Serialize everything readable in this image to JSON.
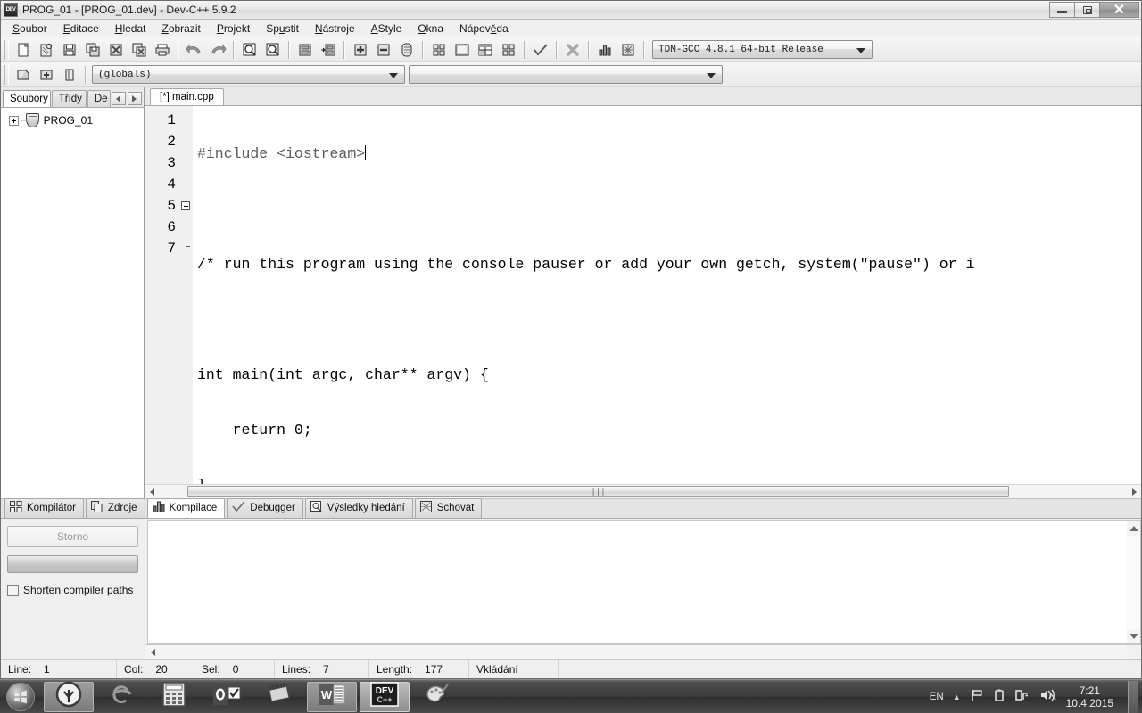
{
  "window": {
    "title": "PROG_01 - [PROG_01.dev] - Dev-C++ 5.9.2",
    "app_icon": "devcpp-icon",
    "minimize_label": "",
    "restore_label": "",
    "close_label": "✕"
  },
  "menubar": {
    "items": [
      {
        "label": "Soubor",
        "accel": "S"
      },
      {
        "label": "Editace",
        "accel": "E"
      },
      {
        "label": "Hledat",
        "accel": "H"
      },
      {
        "label": "Zobrazit",
        "accel": "Z"
      },
      {
        "label": "Projekt",
        "accel": "P"
      },
      {
        "label": "Spustit",
        "accel": "u"
      },
      {
        "label": "Nástroje",
        "accel": "N"
      },
      {
        "label": "AStyle",
        "accel": "A"
      },
      {
        "label": "Okna",
        "accel": "O"
      },
      {
        "label": "Nápověda",
        "accel": "ě"
      }
    ]
  },
  "toolbar1": {
    "buttons": [
      {
        "name": "new-file-icon",
        "tip": "New"
      },
      {
        "name": "open-file-icon",
        "tip": "Open"
      },
      {
        "name": "save-file-icon",
        "tip": "Save"
      },
      {
        "name": "save-all-icon",
        "tip": "Save All"
      },
      {
        "name": "close-file-icon",
        "tip": "Close"
      },
      {
        "name": "close-all-icon",
        "tip": "Close All"
      },
      {
        "name": "print-icon",
        "tip": "Print"
      },
      {
        "name": "undo-icon",
        "tip": "Undo"
      },
      {
        "name": "redo-icon",
        "tip": "Redo"
      },
      {
        "name": "find-icon",
        "tip": "Find"
      },
      {
        "name": "replace-icon",
        "tip": "Replace"
      },
      {
        "name": "goto-line-icon",
        "tip": "Goto Line"
      },
      {
        "name": "goto-function-icon",
        "tip": "Goto Function"
      },
      {
        "name": "insert-icon",
        "tip": "Insert"
      },
      {
        "name": "toggle-icon",
        "tip": "Toggle"
      },
      {
        "name": "bookmark-icon",
        "tip": "Bookmark"
      },
      {
        "name": "compile-icon",
        "tip": "Compile"
      },
      {
        "name": "run-icon",
        "tip": "Run"
      },
      {
        "name": "compile-run-icon",
        "tip": "Compile & Run"
      },
      {
        "name": "rebuild-all-icon",
        "tip": "Rebuild All"
      },
      {
        "name": "check-syntax-icon",
        "tip": "Syntax Check"
      },
      {
        "name": "stop-icon",
        "tip": "Stop Execution"
      },
      {
        "name": "profile-icon",
        "tip": "Profile Analysis"
      },
      {
        "name": "debug-icon",
        "tip": "Debug"
      }
    ],
    "compiler_combo": {
      "value": "TDM-GCC 4.8.1 64-bit Release"
    }
  },
  "toolbar2": {
    "buttons": [
      {
        "name": "project-new-icon",
        "tip": "New Project"
      },
      {
        "name": "project-add-icon",
        "tip": "Add to Project"
      },
      {
        "name": "project-remove-icon",
        "tip": "Remove from Project"
      }
    ],
    "scope_combo": {
      "value": "(globals)"
    },
    "member_combo": {
      "value": ""
    }
  },
  "left_panel": {
    "tabs": [
      {
        "label": "Soubory",
        "active": true
      },
      {
        "label": "Třídy",
        "active": false
      },
      {
        "label": "De",
        "active": false
      }
    ],
    "nav_prev": "◄",
    "nav_next": "►",
    "tree": [
      {
        "label": "PROG_01",
        "icon": "project-shield-icon",
        "expanded": false
      }
    ]
  },
  "editor": {
    "tabs": [
      {
        "label": "[*] main.cpp",
        "active": true
      }
    ],
    "lines": [
      {
        "num": "1",
        "text": "#include <iostream>",
        "style": "preproc",
        "caret": true,
        "fold": "none"
      },
      {
        "num": "2",
        "text": "",
        "style": "plain",
        "caret": false,
        "fold": "none"
      },
      {
        "num": "3",
        "text": "/* run this program using the console pauser or add your own getch, system(\"pause\") or i",
        "style": "plain",
        "caret": false,
        "fold": "none"
      },
      {
        "num": "4",
        "text": "",
        "style": "plain",
        "caret": false,
        "fold": "none"
      },
      {
        "num": "5",
        "text": "int main(int argc, char** argv) {",
        "style": "plain",
        "caret": false,
        "fold": "open"
      },
      {
        "num": "6",
        "text": "    return 0;",
        "style": "plain",
        "caret": false,
        "fold": "body"
      },
      {
        "num": "7",
        "text": "}",
        "style": "plain",
        "caret": false,
        "fold": "end"
      }
    ],
    "hscroll": {
      "left_arrow": "◄",
      "right_arrow": "►",
      "thumb_grip": "|||"
    }
  },
  "bottom_panel": {
    "tabs": [
      {
        "label": "Kompilátor",
        "icon": "compiler-grid-icon",
        "active": false
      },
      {
        "label": "Zdroje",
        "icon": "resources-icon",
        "active": false
      },
      {
        "label": "Kompilace",
        "icon": "compile-log-icon",
        "active": true
      },
      {
        "label": "Debugger",
        "icon": "debugger-check-icon",
        "active": false
      },
      {
        "label": "Výsledky hledání",
        "icon": "search-results-icon",
        "active": false
      },
      {
        "label": "Schovat",
        "icon": "hide-icon",
        "active": false
      }
    ],
    "cancel_button": "Storno",
    "progress_value": "",
    "shorten_paths_label": "Shorten compiler paths",
    "shorten_paths_checked": false,
    "output_text": ""
  },
  "statusbar": {
    "fields": [
      {
        "label": "Line:",
        "value": "1"
      },
      {
        "label": "Col:",
        "value": "20"
      },
      {
        "label": "Sel:",
        "value": "0"
      },
      {
        "label": "Lines:",
        "value": "7"
      },
      {
        "label": "Length:",
        "value": "177"
      }
    ],
    "insert_mode": "Vkládání"
  },
  "taskbar": {
    "start_icon": "windows-start-icon",
    "items": [
      {
        "name": "taskbar-item-tree",
        "icon": "tree-circle-icon",
        "state": "on"
      },
      {
        "name": "taskbar-item-ie",
        "icon": "internet-explorer-icon",
        "state": "off"
      },
      {
        "name": "taskbar-item-calculator",
        "icon": "calculator-icon",
        "state": "off"
      },
      {
        "name": "taskbar-item-outlook",
        "icon": "outlook-icon",
        "state": "off"
      },
      {
        "name": "taskbar-item-chip",
        "icon": "chip-icon",
        "state": "off"
      },
      {
        "name": "taskbar-item-word",
        "icon": "word-icon",
        "state": "on"
      },
      {
        "name": "taskbar-item-devcpp",
        "icon": "devcpp-icon",
        "state": "sel"
      },
      {
        "name": "taskbar-item-paint",
        "icon": "paint-icon",
        "state": "off"
      }
    ],
    "tray": {
      "language": "EN",
      "show_hidden": "▲",
      "flag_icon": "flag-icon",
      "battery_icon": "battery-icon",
      "network_icon": "network-icon",
      "volume_icon": "volume-icon",
      "time": "7:21",
      "date": "10.4.2015"
    }
  }
}
